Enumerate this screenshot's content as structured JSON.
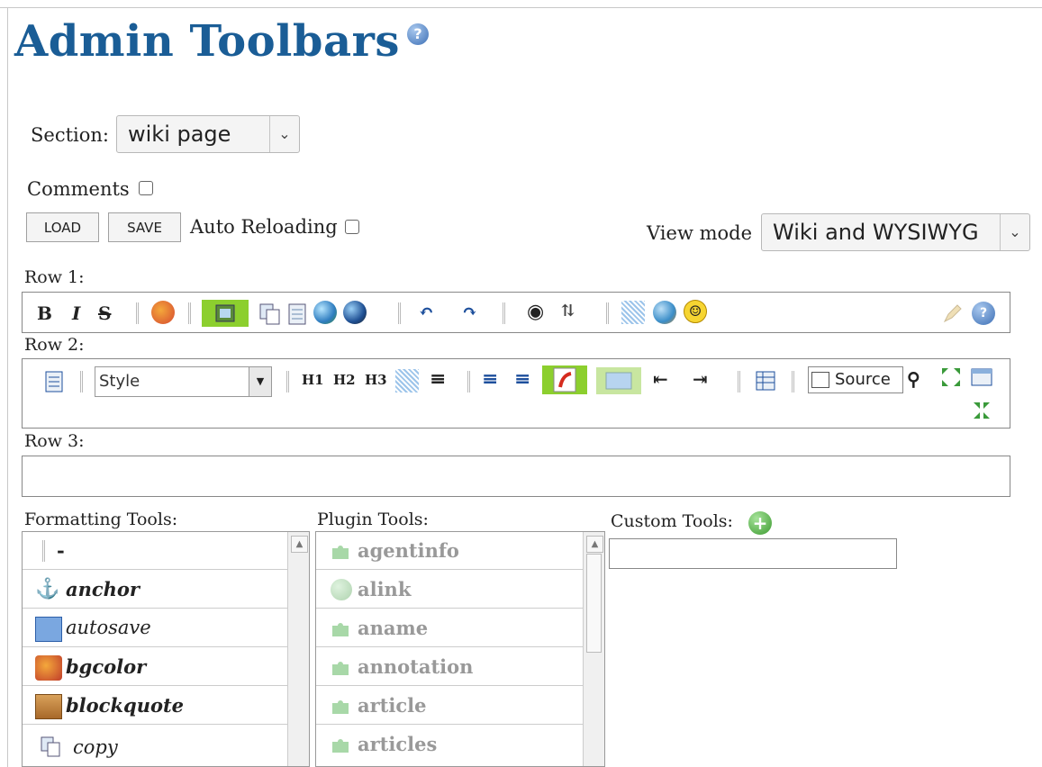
{
  "page": {
    "title": "Admin Toolbars",
    "help_glyph": "?"
  },
  "section": {
    "label": "Section:",
    "value": "wiki page"
  },
  "comments": {
    "label": "Comments"
  },
  "actions": {
    "load_label": "LOAD",
    "save_label": "SAVE",
    "auto_reloading_label": "Auto Reloading"
  },
  "view_mode": {
    "label": "View mode",
    "value": "Wiki and WYSIWYG"
  },
  "rows": {
    "row1_label": "Row 1:",
    "row2_label": "Row 2:",
    "row3_label": "Row 3:",
    "row1": {
      "bold": "B",
      "italic": "I",
      "strike": "S"
    },
    "row2": {
      "style_value": "Style",
      "h1": "H1",
      "h2": "H2",
      "h3": "H3",
      "source": "Source"
    }
  },
  "formatting_tools": {
    "title": "Formatting Tools:",
    "items": [
      {
        "label": "-",
        "icon": "separator-icon"
      },
      {
        "label": "anchor",
        "icon": "anchor-icon"
      },
      {
        "label": "autosave",
        "icon": "floppy-icon"
      },
      {
        "label": "bgcolor",
        "icon": "palette-icon"
      },
      {
        "label": "blockquote",
        "icon": "box-icon"
      },
      {
        "label": "copy",
        "icon": "copy-icon"
      }
    ]
  },
  "plugin_tools": {
    "title": "Plugin Tools:",
    "items": [
      {
        "label": "agentinfo",
        "icon": "puzzle-icon"
      },
      {
        "label": "alink",
        "icon": "link-globe-icon"
      },
      {
        "label": "aname",
        "icon": "puzzle-icon"
      },
      {
        "label": "annotation",
        "icon": "puzzle-icon"
      },
      {
        "label": "article",
        "icon": "puzzle-icon"
      },
      {
        "label": "articles",
        "icon": "puzzle-icon"
      }
    ]
  },
  "custom_tools": {
    "title": "Custom Tools:",
    "add_glyph": "+"
  },
  "colors": {
    "title": "#1a5d96",
    "active_icon_bg": "#8ccf2e",
    "disabled_text": "#999999"
  }
}
